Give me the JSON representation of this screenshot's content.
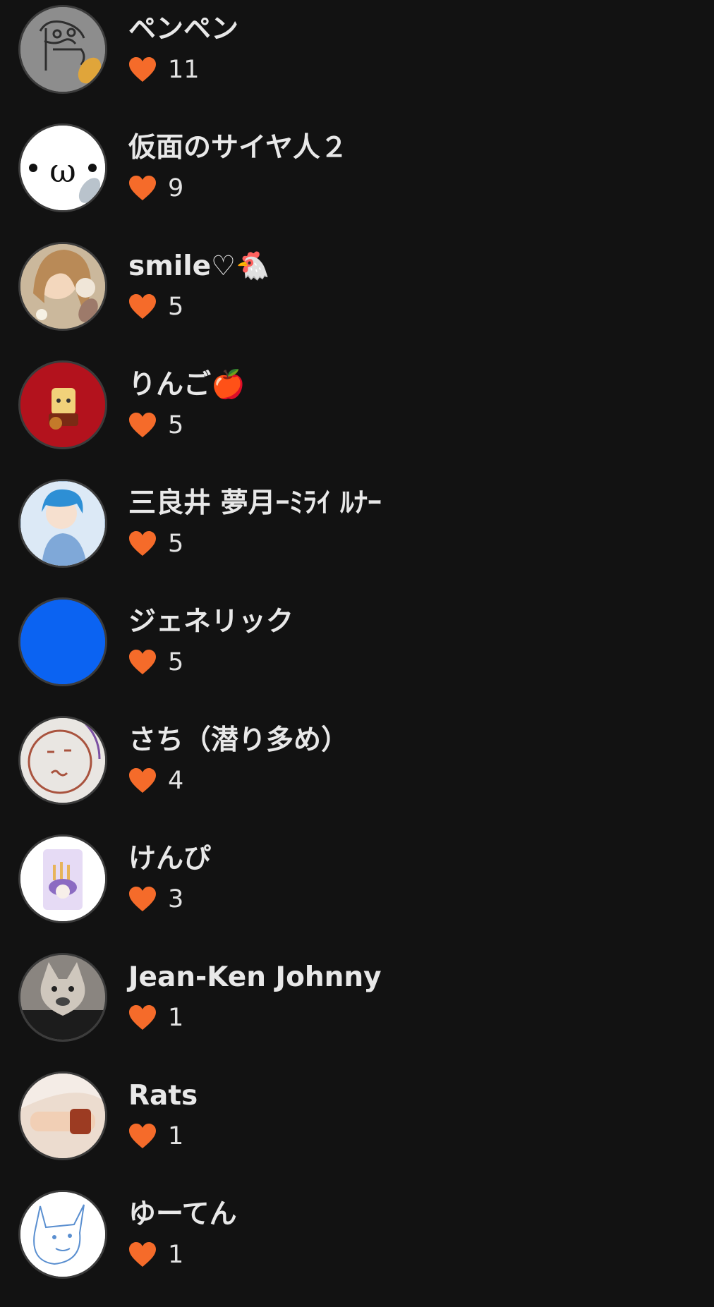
{
  "theme": {
    "background": "#121212",
    "heart_color": "#f56b2a",
    "text_color": "#e8e8e8"
  },
  "like_icon": "heart-icon",
  "users": [
    {
      "name": "ペンペン",
      "likes": "11",
      "avatar": "doodle-face-avatar",
      "avatar_color": "#8d8d8d"
    },
    {
      "name": "仮面のサイヤ人２",
      "likes": "9",
      "avatar": "kaomoji-face-avatar",
      "avatar_color": "#ffffff"
    },
    {
      "name": "smile♡🐔",
      "likes": "5",
      "avatar": "anime-girl-avatar",
      "avatar_color": "#c9b59a"
    },
    {
      "name": "りんご🍎",
      "likes": "5",
      "avatar": "red-character-avatar",
      "avatar_color": "#b3121d"
    },
    {
      "name": "三良井 夢月ｰﾐﾗｲ ﾙﾅｰ",
      "likes": "5",
      "avatar": "blue-hair-boy-avatar",
      "avatar_color": "#cfe2f4"
    },
    {
      "name": "ジェネリック",
      "likes": "5",
      "avatar": "solid-blue-avatar",
      "avatar_color": "#0b63f2"
    },
    {
      "name": "さち（潜り多め）",
      "likes": "4",
      "avatar": "drawn-face-avatar",
      "avatar_color": "#e9e6e2"
    },
    {
      "name": "けんぴ",
      "likes": "3",
      "avatar": "snack-bag-avatar",
      "avatar_color": "#ffffff"
    },
    {
      "name": "Jean-Ken Johnny",
      "likes": "1",
      "avatar": "wolf-mask-avatar",
      "avatar_color": "#6e6a66"
    },
    {
      "name": "Rats",
      "likes": "1",
      "avatar": "anime-hand-avatar",
      "avatar_color": "#e8d2c2"
    },
    {
      "name": "ゆーてん",
      "likes": "1",
      "avatar": "sketch-cat-avatar",
      "avatar_color": "#ffffff"
    }
  ]
}
